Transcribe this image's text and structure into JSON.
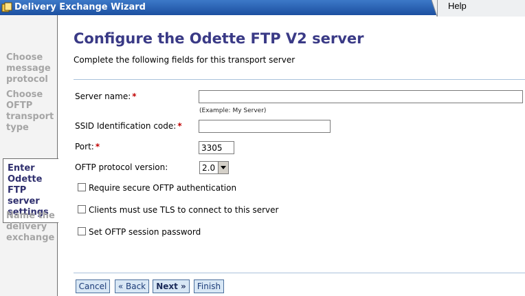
{
  "window": {
    "title": "Delivery Exchange Wizard",
    "help_label": "Help"
  },
  "sidebar": {
    "steps": [
      {
        "label": "Choose message protocol",
        "state": "done"
      },
      {
        "label": "Choose OFTP transport type",
        "state": "done"
      },
      {
        "label": "Enter Odette FTP server settings",
        "state": "active"
      },
      {
        "label": "Name the delivery exchange",
        "state": "pending"
      }
    ]
  },
  "main": {
    "title": "Configure the Odette FTP V2 server",
    "subtitle": "Complete the following fields for this transport server",
    "fields": {
      "server_name": {
        "label": "Server name:",
        "required_mark": "*",
        "value": "",
        "example": "(Example: My Server)"
      },
      "ssid": {
        "label": "SSID Identification code:",
        "required_mark": "*",
        "value": ""
      },
      "port": {
        "label": "Port:",
        "required_mark": "*",
        "value": "3305"
      },
      "oftp_version": {
        "label": "OFTP protocol version:",
        "value": "2.0"
      }
    },
    "options": [
      {
        "label": "Require secure OFTP authentication",
        "checked": false
      },
      {
        "label": "Clients must use TLS to connect to this server",
        "checked": false
      },
      {
        "label": "Set OFTP session password",
        "checked": false
      }
    ]
  },
  "buttons": {
    "cancel": "Cancel",
    "back": "« Back",
    "next": "Next »",
    "finish": "Finish"
  }
}
